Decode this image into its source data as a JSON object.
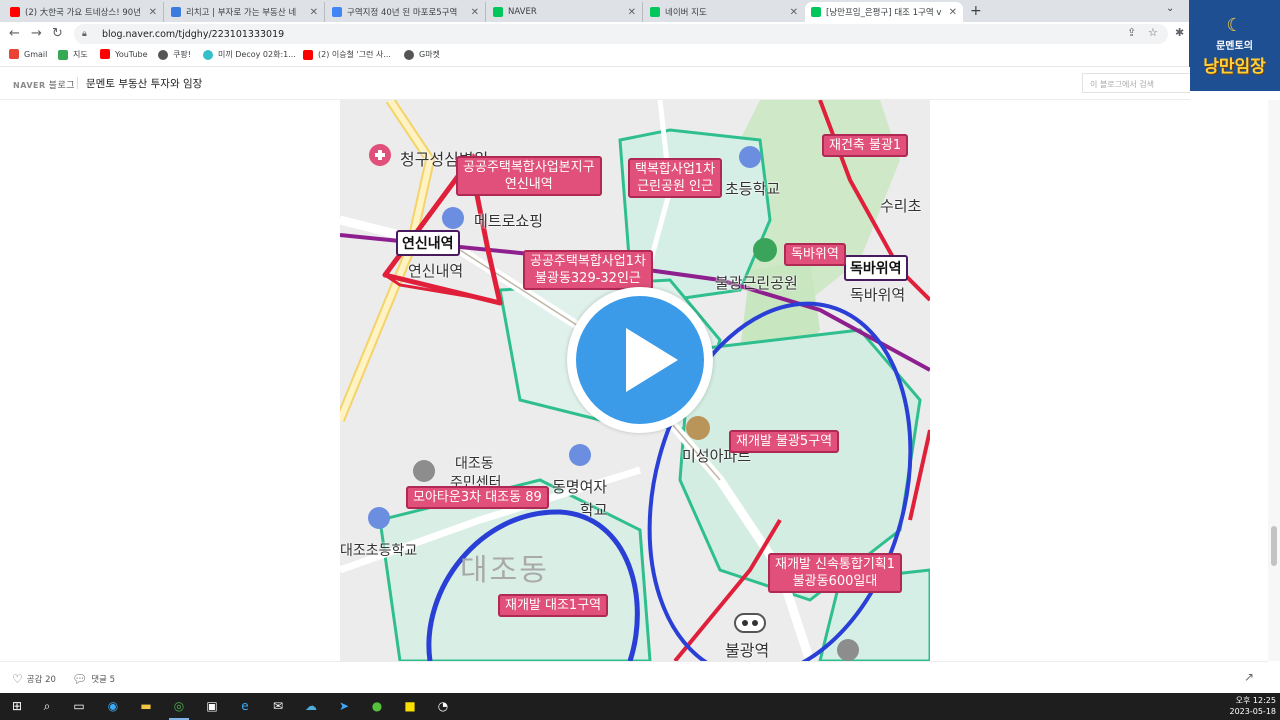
{
  "browser": {
    "tabs": [
      {
        "title": "(2) 大한국 가요 트네상스! 90년",
        "icon_color": "#ff0000",
        "active": false
      },
      {
        "title": "리치고 | 부자로 가는 부동산 네",
        "icon_color": "#3b7be0",
        "active": false
      },
      {
        "title": "구역지정 40년 된 마포로5구역",
        "icon_color": "#4285f4",
        "active": false
      },
      {
        "title": "NAVER",
        "icon_color": "#03c75a",
        "active": false
      },
      {
        "title": "네이버 지도",
        "icon_color": "#03c75a",
        "active": false
      },
      {
        "title": "[낭만프임_은평구] 대조 1구역 v",
        "icon_color": "#03c75a",
        "active": true
      }
    ],
    "new_tab": "+",
    "url": "blog.naver.com/tjdghy/223101333019",
    "bookmarks": [
      {
        "label": "Gmail",
        "icon_color": "#ea4335"
      },
      {
        "label": "지도",
        "icon_color": "#34a853"
      },
      {
        "label": "YouTube",
        "icon_color": "#ff0000"
      },
      {
        "label": "쿠팡!",
        "icon_color": "#555555"
      },
      {
        "label": "미끼 Decoy 02화:1...",
        "icon_color": "#35c0c8"
      },
      {
        "label": "(2) 이승철 '그런 사...",
        "icon_color": "#ff0000"
      },
      {
        "label": "G마켓",
        "icon_color": "#555555"
      }
    ]
  },
  "logo": {
    "line1": "문멘토의",
    "line2": "낭만임장"
  },
  "blog": {
    "brand": "NAVER",
    "brand_sub": "블로그",
    "title": "문멘토 부동산 투자와 임장",
    "search_placeholder": "이 블로그에서 검색"
  },
  "map": {
    "labels": [
      "공공주택복합사업본지구\n연신내역",
      "택복합사업1차\n근린공원 인근",
      "공공주택복합사업1차\n불광동329-32인근",
      "재건축 불광1",
      "독바위역",
      "재개발 불광5구역",
      "모아타운3차 대조동 89",
      "재개발 대조1구역",
      "재개발 신속통합기획1\n불광동600일대"
    ],
    "stations": [
      "연신내역",
      "독바위역"
    ],
    "place_names": [
      "청구성심병원",
      "메트로쇼핑",
      "연신내역",
      "초등학교",
      "수리초",
      "불광근린공원",
      "독바위역",
      "미성아파트",
      "대조동",
      "주민센터",
      "동명여자",
      "학교",
      "대조초등학교",
      "대조동",
      "불광역"
    ],
    "colors": {
      "label_fill": "#e0507a",
      "red_line": "#e0203a",
      "blue_circle": "#2a3fd6",
      "purple_line": "#8e1f8e",
      "green_zone": "#2fbf8f"
    }
  },
  "bottom": {
    "like": "공감 20",
    "comment": "댓글 5"
  },
  "taskbar": {
    "time": "오후 12:25",
    "date": "2023-05-18"
  }
}
